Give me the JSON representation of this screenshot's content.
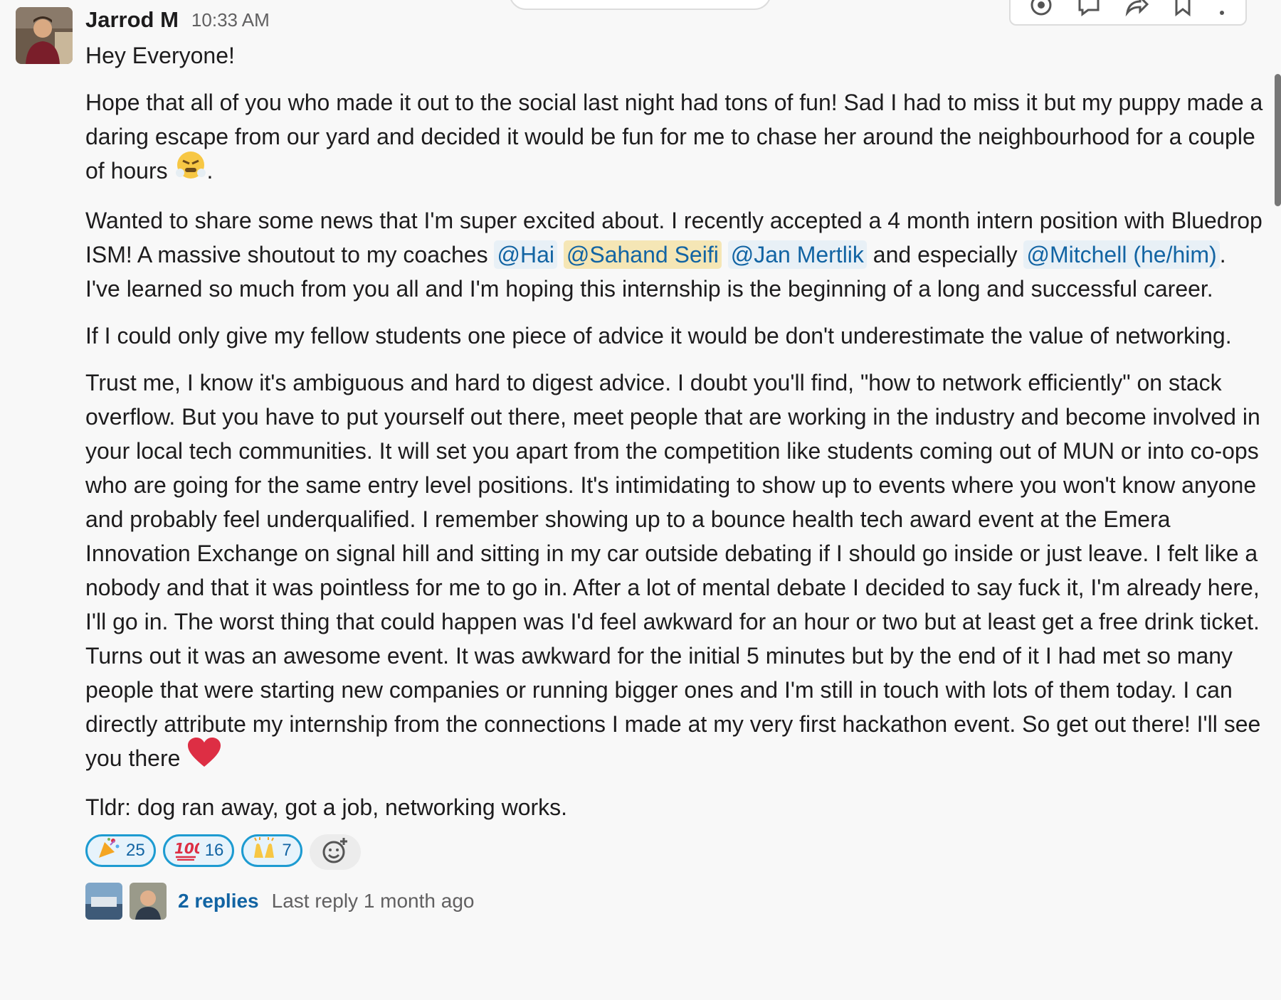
{
  "message": {
    "author": "Jarrod M",
    "timestamp": "10:33 AM",
    "greeting": "Hey Everyone!",
    "para1": "Hope that all of you who made it out to the social last night had tons of fun! Sad I had to miss it but my puppy made a daring escape from our yard and decided it would be fun for me to chase her around the neighbourhood for a couple of hours",
    "para1_end": ".",
    "para2_a": "Wanted to share some news that I'm super excited about. I recently accepted a 4 month intern position with Bluedrop ISM! A massive shoutout to my coaches",
    "mention_hai": "@Hai",
    "mention_sahand": "@Sahand Seifi",
    "mention_jan": "@Jan Mertlik",
    "para2_b": "and especially",
    "mention_mitchell": "@Mitchell (he/him)",
    "para2_c": ". I've learned so much from you all and I'm hoping this internship is the beginning of a long and successful career.",
    "para3": "If I could only give my fellow students one piece of advice it would be don't underestimate the value of networking.",
    "para4": "Trust me, I know it's ambiguous and hard to digest advice. I doubt you'll find, \"how to network efficiently\" on stack overflow. But you have to put yourself out there, meet people that are working in the industry and become involved in your local tech communities. It will set you apart from the competition like students coming out of MUN or into co-ops who are going for the same entry level positions. It's intimidating to show up to events where you won't know anyone and probably feel underqualified. I remember showing up to a bounce health tech award event at the Emera Innovation Exchange on signal hill and sitting in my car outside debating if I should go inside or just leave. I felt like a nobody and that it was pointless for me to go in. After a lot of mental debate I decided to say fuck it, I'm already here, I'll go in. The worst thing that could happen was I'd feel awkward for an hour or two but at least get a free drink ticket. Turns out it was an awesome event. It was awkward for the initial 5 minutes but by the end of it I had met so many people that were starting new companies or running bigger ones and I'm still in touch with lots of them today. I can directly attribute my internship from the connections I made at my very first hackathon event. So get out there! I'll see you there",
    "para5": "Tldr: dog ran away, got a job, networking works."
  },
  "reactions": [
    {
      "emoji": "tada",
      "count": "25"
    },
    {
      "emoji": "100",
      "count": "16"
    },
    {
      "emoji": "raised-hands",
      "count": "7"
    }
  ],
  "thread": {
    "replies": "2 replies",
    "last_reply": "Last reply 1 month ago"
  },
  "colors": {
    "mention_bg": "#e8f0f6",
    "mention_self_bg": "#f5e6b5",
    "link": "#1264a3",
    "reaction_border": "#1d9bd1"
  }
}
